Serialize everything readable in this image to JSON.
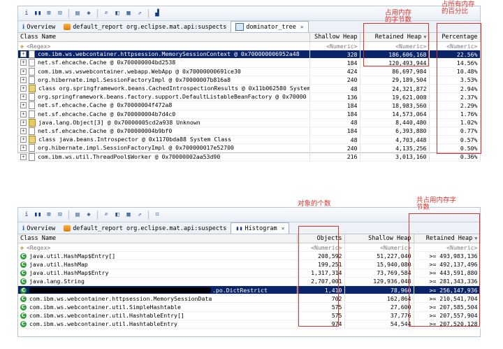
{
  "top": {
    "tabs": [
      {
        "label": "Overview",
        "icon": "info-icon"
      },
      {
        "label": "default_report  org.eclipse.mat.api:suspects",
        "icon": "report-icon"
      },
      {
        "label": "dominator_tree",
        "icon": "tree-icon",
        "active": true
      }
    ],
    "columns": [
      "Class Name",
      "Shallow Heap",
      "Retained Heap",
      "Percentage"
    ],
    "regex_row": [
      "<Regex>",
      "<Numeric>",
      "<Numeric>",
      "<Numeric>"
    ],
    "rows": [
      {
        "name": "com.ibm.ws.webcontainer.httpsession.MemorySessionContext @ 0x700000006952a48",
        "shallow": "328",
        "retained": "186,606,168",
        "pct": "22.56%",
        "icon": "doc",
        "selected": true
      },
      {
        "name": "net.sf.ehcache.Cache @ 0x700000004bd2538",
        "shallow": "184",
        "retained": "120,493,944",
        "pct": "14.56%",
        "icon": "doc"
      },
      {
        "name": "com.ibm.ws.wswebcontainer.webapp.WebApp @ 0x70000000691ce30",
        "shallow": "424",
        "retained": "86,697,984",
        "pct": "10.48%",
        "icon": "doc"
      },
      {
        "name": "org.hibernate.impl.SessionFactoryImpl @ 0x70000007b816a8",
        "shallow": "240",
        "retained": "29,189,504",
        "pct": "3.53%",
        "icon": "doc"
      },
      {
        "name": "class org.springframework.beans.CachedIntrospectionResults @ 0x11b062580 System",
        "shallow": "48",
        "retained": "24,321,872",
        "pct": "2.94%",
        "icon": "class"
      },
      {
        "name": "org.springframework.beans.factory.support.DefaultListableBeanFactory @ 0x70000",
        "shallow": "136",
        "retained": "19,621,008",
        "pct": "2.37%",
        "icon": "doc"
      },
      {
        "name": "net.sf.ehcache.Cache @ 0x70000004f472a8",
        "shallow": "184",
        "retained": "18,983,560",
        "pct": "2.29%",
        "icon": "doc"
      },
      {
        "name": "net.sf.ehcache.Cache @ 0x700000004b7d4c0",
        "shallow": "184",
        "retained": "14,573,064",
        "pct": "1.76%",
        "icon": "doc"
      },
      {
        "name": "java.lang.Object[3] @ 0x70000005cd2a938 Unknown",
        "shallow": "48",
        "retained": "8,440,480",
        "pct": "1.02%",
        "icon": "obj"
      },
      {
        "name": "net.sf.ehcache.Cache @ 0x700000004b9bf0",
        "shallow": "184",
        "retained": "6,393,880",
        "pct": "0.77%",
        "icon": "doc"
      },
      {
        "name": "class java.beans.Introspector @ 0x1170bda88 System Class",
        "shallow": "48",
        "retained": "4,703,448",
        "pct": "0.57%",
        "icon": "class"
      },
      {
        "name": "org.hibernate.impl.SessionFactoryImpl @ 0x700000017e52700",
        "shallow": "240",
        "retained": "4,135,256",
        "pct": "0.50%",
        "icon": "doc"
      },
      {
        "name": "com.ibm.ws.util.ThreadPool$Worker @ 0x70000002aa53d90",
        "shallow": "216",
        "retained": "3,013,160",
        "pct": "0.36%",
        "icon": "doc"
      }
    ],
    "note_retained": "占用内存\n的字节数",
    "note_pct": "占所有内存\n的百分比"
  },
  "bottom": {
    "tabs": [
      {
        "label": "Overview",
        "icon": "info-icon"
      },
      {
        "label": "default_report  org.eclipse.mat.api:suspects",
        "icon": "report-icon"
      },
      {
        "label": "Histogram",
        "icon": "histogram-icon",
        "active": true
      }
    ],
    "columns": [
      "Class Name",
      "Objects",
      "Shallow Heap",
      "Retained Heap"
    ],
    "regex_row": [
      "<Regex>",
      "<Numeric>",
      "<Numeric>",
      "<Numeric>"
    ],
    "rows": [
      {
        "name": "java.util.HashMap$Entry[]",
        "objects": "208,592",
        "shallow": "51,227,040",
        "retained": ">= 493,983,136"
      },
      {
        "name": "java.util.HashMap",
        "objects": "199,251",
        "shallow": "15,940,080",
        "retained": ">= 492,137,496"
      },
      {
        "name": "java.util.HashMap$Entry",
        "objects": "1,317,314",
        "shallow": "73,769,584",
        "retained": ">= 443,591,880"
      },
      {
        "name": "java.lang.String",
        "objects": "2,707,001",
        "shallow": "129,936,048",
        "retained": ">= 281,343,336"
      },
      {
        "name": ".po.DictRestrict",
        "objects": "1,410",
        "shallow": "78,960",
        "retained": ">= 256,147,936",
        "selected": true,
        "redacted": true
      },
      {
        "name": "com.ibm.ws.webcontainer.httpsession.MemorySessionData",
        "objects": "702",
        "shallow": "162,864",
        "retained": ">= 210,541,704"
      },
      {
        "name": "com.ibm.ws.webcontainer.util.SimpleHashtable",
        "objects": "575",
        "shallow": "27,600",
        "retained": ">= 207,585,504"
      },
      {
        "name": "com.ibm.ws.webcontainer.util.HashtableEntry[]",
        "objects": "575",
        "shallow": "37,776",
        "retained": ">= 207,557,904"
      },
      {
        "name": "com.ibm.ws.webcontainer.util.HashtableEntry",
        "objects": "974",
        "shallow": "54,544",
        "retained": ">= 207,520,128"
      }
    ],
    "note_objects": "对象的个数",
    "note_retained": "共占用内存字\n节数"
  },
  "colors": {
    "selection": "#0a246a",
    "annotation": "#e0302a",
    "class_icon": "#2f9e3a"
  }
}
